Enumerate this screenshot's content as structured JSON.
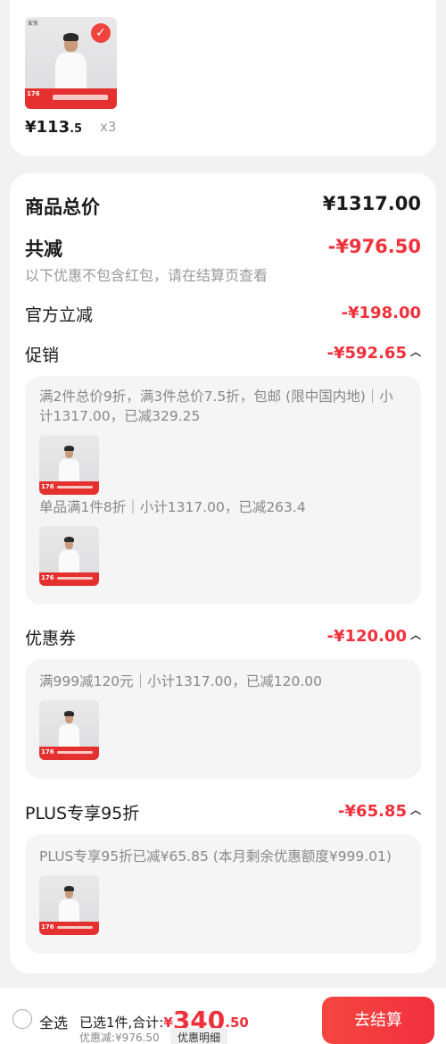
{
  "product": {
    "price_int": "¥113",
    "price_dec": ".5",
    "qty": "x3",
    "thumb_badge": "176",
    "brand": "安东"
  },
  "summary": {
    "total_label": "商品总价",
    "total_value": "¥1317.00",
    "reduce_label": "共减",
    "reduce_value": "-¥976.50",
    "note": "以下优惠不包含红包，请在结算页查看",
    "official_label": "官方立减",
    "official_value": "-¥198.00",
    "promo_label": "促销",
    "promo_value": "-¥592.65",
    "promo_box": {
      "rule1": "满2件总价9折，满3件总价7.5折，包邮 (限中国内地)｜小计1317.00，已减329.25",
      "rule2": "单品满1件8折｜小计1317.00，已减263.4"
    },
    "coupon_label": "优惠券",
    "coupon_value": "-¥120.00",
    "coupon_box": {
      "rule": "满999减120元｜小计1317.00，已减120.00"
    },
    "plus_label": "PLUS专享95折",
    "plus_value": "-¥65.85",
    "plus_box": {
      "rule": "PLUS专享95折已减¥65.85 (本月剩余优惠额度¥999.01)"
    }
  },
  "bottom": {
    "select_all": "全选",
    "selected_text": "已选1件,合计:",
    "yen": "¥",
    "total_int": "340",
    "total_dec": ".50",
    "discount_text": "优惠减:¥976.50",
    "detail_btn": "优惠明细",
    "checkout_btn": "去结算"
  }
}
